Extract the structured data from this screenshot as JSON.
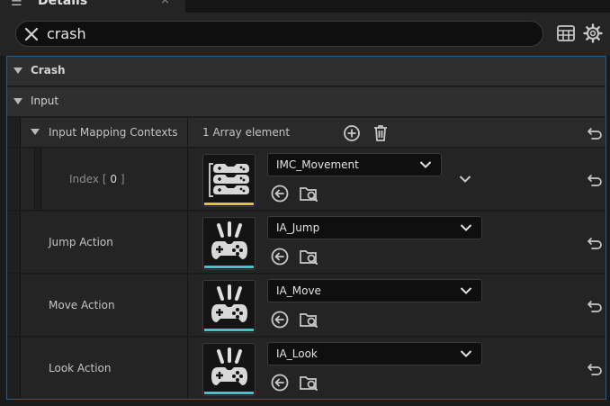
{
  "tab": {
    "title": "Details",
    "close": "×"
  },
  "search": {
    "value": "crash"
  },
  "categories": {
    "crash": "Crash",
    "input": "Input"
  },
  "mapping": {
    "label": "Input Mapping Contexts",
    "count": "1 Array element"
  },
  "index_row": {
    "label_prefix": "Index [",
    "index": "0",
    "label_suffix": "]",
    "asset": "IMC_Movement"
  },
  "rows": [
    {
      "label": "Jump Action",
      "asset": "IA_Jump"
    },
    {
      "label": "Move Action",
      "asset": "IA_Move"
    },
    {
      "label": "Look Action",
      "asset": "IA_Look"
    }
  ],
  "colors": {
    "accent_border": "#245c8a",
    "imc_underline": "#d9c43c",
    "ia_underline": "#3fc7c7"
  },
  "icons": {
    "clear": "close-icon",
    "table": "table-view-icon",
    "settings": "gear-icon",
    "add": "add-element-icon",
    "delete": "trash-icon",
    "reset": "reset-to-default-icon",
    "use": "use-selected-icon",
    "browse": "browse-asset-icon",
    "expand": "chevron-down-icon"
  }
}
